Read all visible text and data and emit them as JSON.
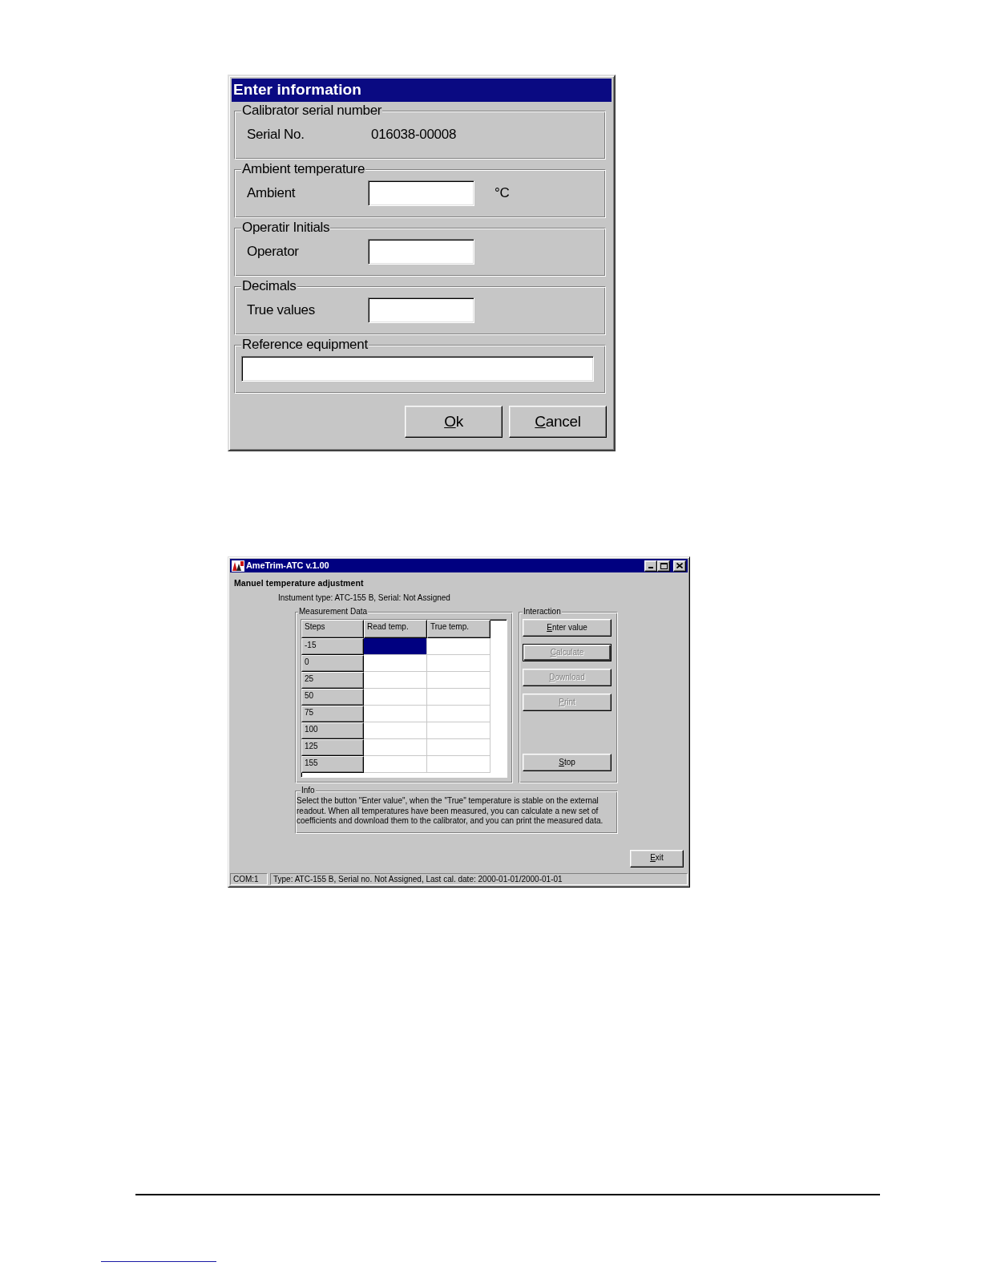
{
  "dialog": {
    "title": "Enter information",
    "groups": [
      {
        "kind": "readout",
        "legend": "Calibrator serial number",
        "label": "Serial No.",
        "value": "016038-00008"
      },
      {
        "kind": "input",
        "legend": "Ambient temperature",
        "label": "Ambient",
        "unit": "°C"
      },
      {
        "kind": "input",
        "legend": "Operatir Initials",
        "label": "Operator"
      },
      {
        "kind": "input",
        "legend": "Decimals",
        "label": "True values"
      },
      {
        "kind": "wide_input",
        "legend": "Reference equipment"
      }
    ],
    "buttons": [
      {
        "label": "Ok",
        "underline_first_letter": true
      },
      {
        "label": "Cancel",
        "underline_first_letter": true
      }
    ]
  },
  "window": {
    "title": "AmeTrim-ATC v.1.00",
    "heading": "Manuel temperature adjustment",
    "instrument": "Instument type: ATC-155 B, Serial: Not Assigned",
    "measurement": {
      "legend": "Measurement Data",
      "columns": [
        "Steps",
        "Read temp.",
        "True temp."
      ],
      "rows": [
        {
          "step": "-15",
          "selected": true
        },
        {
          "step": "0",
          "selected": false
        },
        {
          "step": "25",
          "selected": false
        },
        {
          "step": "50",
          "selected": false
        },
        {
          "step": "75",
          "selected": false
        },
        {
          "step": "100",
          "selected": false
        },
        {
          "step": "125",
          "selected": false
        },
        {
          "step": "155",
          "selected": false
        }
      ]
    },
    "interaction": {
      "legend": "Interaction",
      "buttons": [
        {
          "label": "Enter value",
          "underline_first_letter": true,
          "disabled": false,
          "default": false
        },
        {
          "label": "Calculate",
          "underline_first_letter": true,
          "disabled": true,
          "default": true
        },
        {
          "label": "Download",
          "underline_first_letter": true,
          "disabled": true,
          "default": false
        },
        {
          "label": "Print",
          "underline_first_letter": true,
          "disabled": true,
          "default": false
        },
        {
          "label": "Stop",
          "underline_first_letter": true,
          "disabled": false,
          "default": false
        }
      ]
    },
    "info": {
      "legend": "Info",
      "text": "Select the button \"Enter value\", when the \"True\" temperature is stable on the external readout. When all temperatures have been measured, you can calculate a new set of coefficients and download them to the calibrator, and you can print the measured data."
    },
    "exit_button": {
      "label": "Exit",
      "underline_first_letter": true
    },
    "status_bar": [
      "COM:1",
      "Type: ATC-155 B, Serial no. Not Assigned, Last cal. date: 2000-01-01/2000-01-01"
    ]
  }
}
